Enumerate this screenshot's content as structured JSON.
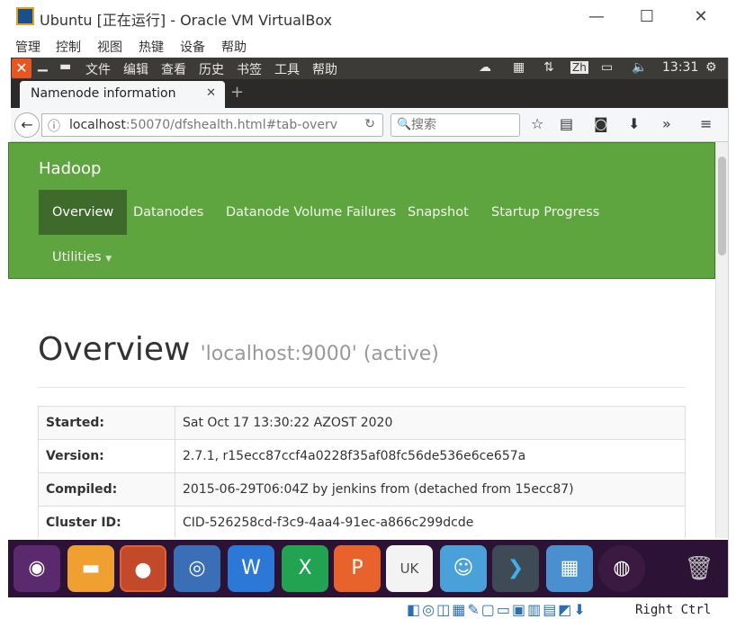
{
  "vbox": {
    "title": "Ubuntu [正在运行] - Oracle VM VirtualBox",
    "menu": [
      "管理",
      "控制",
      "视图",
      "热键",
      "设备",
      "帮助"
    ],
    "minimize": "—",
    "maximize": "☐",
    "close": "✕",
    "host_key": "Right Ctrl"
  },
  "ubuntu_panel": {
    "close_glyph": "✕",
    "menus": [
      "文件",
      "编辑",
      "查看",
      "历史",
      "书签",
      "工具",
      "帮助"
    ],
    "input_method": "Zh",
    "clock": "13:31"
  },
  "firefox": {
    "tab_title": "Namenode information",
    "tab_close": "✕",
    "new_tab": "+",
    "url_host": "localhost",
    "url_rest": ":50070/dfshealth.html#tab-overv",
    "search_placeholder": "搜索"
  },
  "hadoop": {
    "brand": "Hadoop",
    "nav": {
      "overview": "Overview",
      "datanodes": "Datanodes",
      "volume_failures": "Datanode Volume Failures",
      "snapshot": "Snapshot",
      "startup_progress": "Startup Progress",
      "utilities": "Utilities"
    },
    "heading": "Overview",
    "heading_sub": "'localhost:9000' (active)",
    "table": [
      {
        "key": "Started:",
        "value": "Sat Oct 17 13:30:22 AZOST 2020"
      },
      {
        "key": "Version:",
        "value": "2.7.1, r15ecc87ccf4a0228f35af08fc56de536e6ce657a"
      },
      {
        "key": "Compiled:",
        "value": "2015-06-29T06:04Z by jenkins from (detached from 15ecc87)"
      },
      {
        "key": "Cluster ID:",
        "value": "CID-526258cd-f3c9-4aa4-91ec-a866c299dcde"
      }
    ]
  },
  "dock": {
    "uk_label": "UK"
  }
}
